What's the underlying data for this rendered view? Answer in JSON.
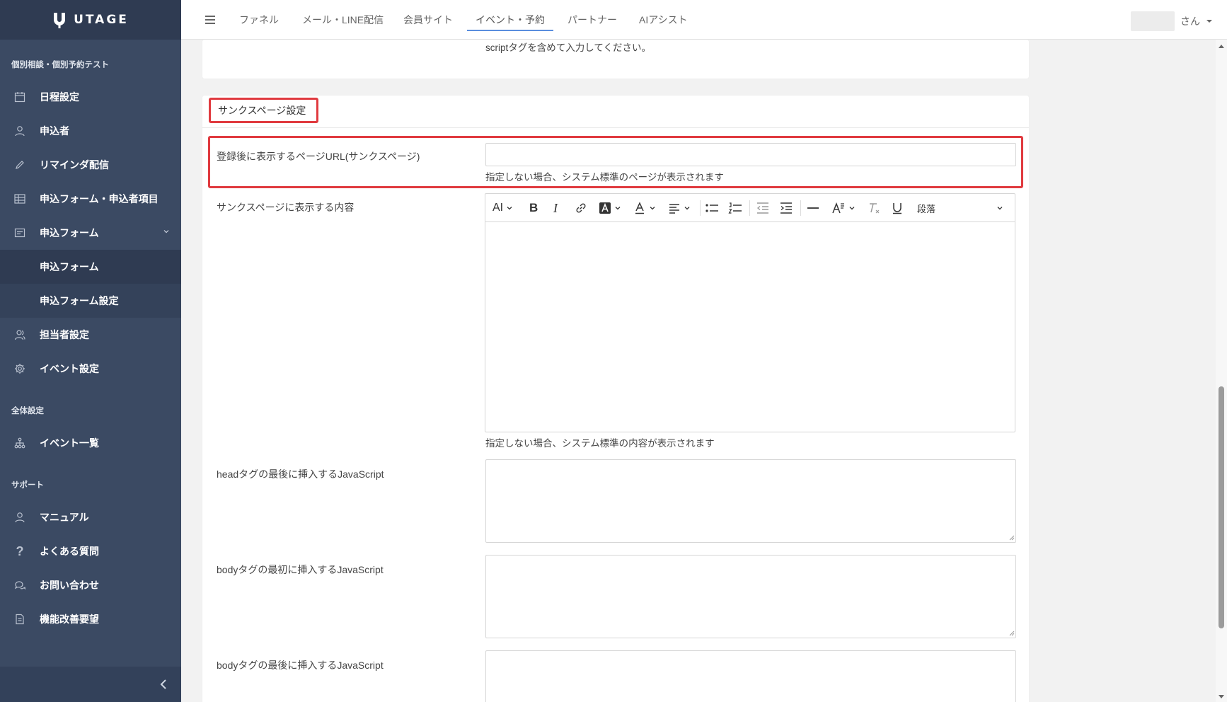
{
  "brand": {
    "name": "UTAGE"
  },
  "sidebar": {
    "section_project": "個別相談・個別予約テスト",
    "items": [
      {
        "label": "日程設定",
        "icon": "calendar-icon"
      },
      {
        "label": "申込者",
        "icon": "user-icon"
      },
      {
        "label": "リマインダ配信",
        "icon": "pencil-icon"
      },
      {
        "label": "申込フォーム・申込者項目",
        "icon": "table-icon"
      },
      {
        "label": "申込フォーム",
        "icon": "form-icon"
      }
    ],
    "sub_items": [
      {
        "label": "申込フォーム"
      },
      {
        "label": "申込フォーム設定"
      }
    ],
    "items2": [
      {
        "label": "担当者設定",
        "icon": "users-icon"
      },
      {
        "label": "イベント設定",
        "icon": "gear-icon"
      }
    ],
    "section_global": "全体設定",
    "items3": [
      {
        "label": "イベント一覧",
        "icon": "sitemap-icon"
      }
    ],
    "section_support": "サポート",
    "items4": [
      {
        "label": "マニュアル",
        "icon": "user-icon"
      },
      {
        "label": "よくある質問",
        "icon": "question-icon"
      },
      {
        "label": "お問い合わせ",
        "icon": "chat-icon"
      },
      {
        "label": "機能改善要望",
        "icon": "document-icon"
      }
    ]
  },
  "topnav": {
    "tabs": [
      {
        "label": "ファネル"
      },
      {
        "label": "メール・LINE配信"
      },
      {
        "label": "会員サイト"
      },
      {
        "label": "イベント・予約"
      },
      {
        "label": "パートナー"
      },
      {
        "label": "AIアシスト"
      }
    ],
    "active_tab": "イベント・予約",
    "user_suffix": "さん"
  },
  "main": {
    "top_hint": "scriptタグを含めて入力してください。",
    "section_title": "サンクスページ設定",
    "thanks_url": {
      "label": "登録後に表示するページURL(サンクスページ)",
      "value": "",
      "hint": "指定しない場合、システム標準のページが表示されます"
    },
    "thanks_content": {
      "label": "サンクスページに表示する内容",
      "hint": "指定しない場合、システム標準の内容が表示されます",
      "toolbar": {
        "ai": "AI",
        "bold": "B",
        "italic": "I",
        "heading_style": "段落"
      }
    },
    "head_js": {
      "label": "headタグの最後に挿入するJavaScript",
      "value": ""
    },
    "body_start_js": {
      "label": "bodyタグの最初に挿入するJavaScript",
      "value": ""
    },
    "body_end_js": {
      "label": "bodyタグの最後に挿入するJavaScript",
      "value": ""
    }
  },
  "colors": {
    "sidebar_bg": "#3b4a63",
    "highlight": "#e03a3f",
    "tab_underline": "#5a8ede"
  }
}
